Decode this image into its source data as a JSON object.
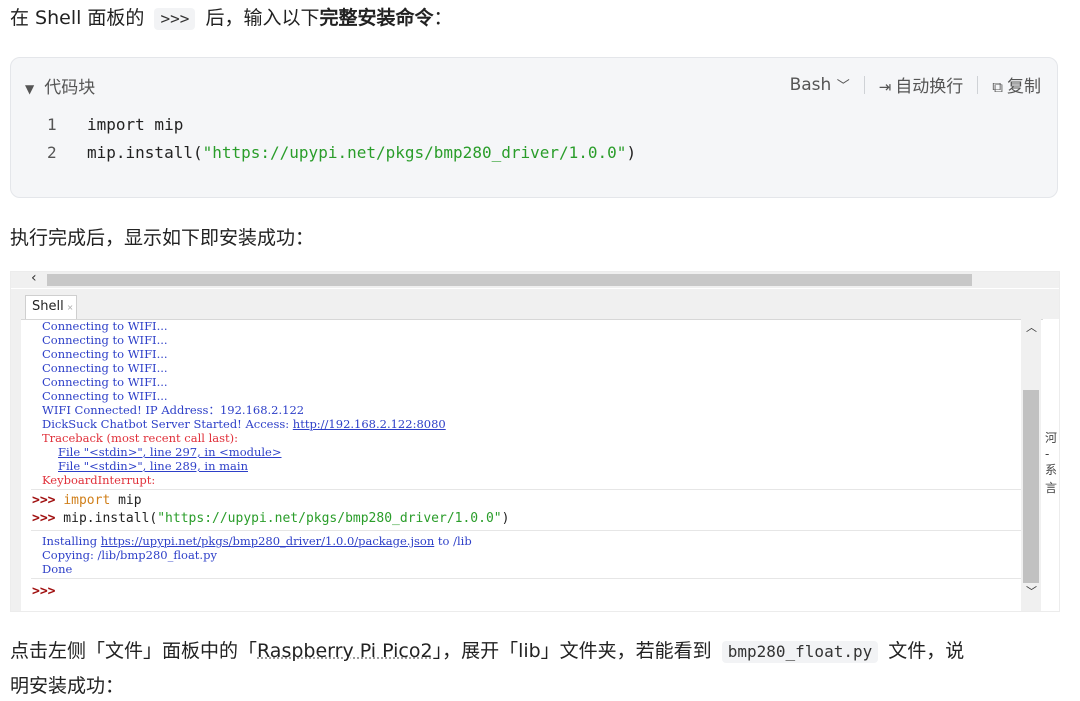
{
  "intro": {
    "prefix": "在 Shell 面板的",
    "prompt": ">>>",
    "middle": "后，输入以下",
    "bold": "完整安装命令",
    "suffix": "："
  },
  "codeblock": {
    "title": "代码块",
    "language": "Bash",
    "wrap_label": "自动换行",
    "copy_label": "复制",
    "lines": [
      {
        "num": "1",
        "text": "import mip"
      },
      {
        "num": "2",
        "pre": "mip.install(",
        "str": "\"https://upypi.net/pkgs/bmp280_driver/1.0.0\"",
        "post": ")"
      }
    ]
  },
  "after_text": "执行完成后，显示如下即安装成功：",
  "shell": {
    "tab_label": "Shell",
    "lines": [
      "Connecting to WIFI...",
      "Connecting to WIFI...",
      "Connecting to WIFI...",
      "Connecting to WIFI...",
      "Connecting to WIFI...",
      "Connecting to WIFI...",
      "WIFI Connected! IP Address：192.168.2.122"
    ],
    "server_prefix": "DickSuck Chatbot Server Started! Access: ",
    "server_url": "http://192.168.2.122:8080",
    "traceback": "Traceback (most recent call last):",
    "file1": "File \"<stdin>\", line 297, in <module>",
    "file2": "File \"<stdin>\", line 289, in main",
    "interrupt": "KeyboardInterrupt:",
    "prompt": ">>>",
    "cmd1_kw": "import",
    "cmd1_rest": " mip",
    "cmd2_pre": " mip.install(",
    "cmd2_str": "\"https://upypi.net/pkgs/bmp280_driver/1.0.0\"",
    "cmd2_post": ")",
    "install_prefix": "Installing ",
    "install_url": "https://upypi.net/pkgs/bmp280_driver/1.0.0/package.json",
    "install_suffix": " to /lib",
    "copying": "Copying: /lib/bmp280_float.py",
    "done": "Done",
    "side_chars": [
      "河",
      "-系",
      "言"
    ]
  },
  "outro": {
    "part1": "点击左侧「文件」面板中的「",
    "device": "Raspberry Pi Pico2",
    "part2": "」，展开「lib」文件夹，若能看到",
    "filename": "bmp280_float.py",
    "part3": "文件，说",
    "line2": "明安装成功："
  }
}
